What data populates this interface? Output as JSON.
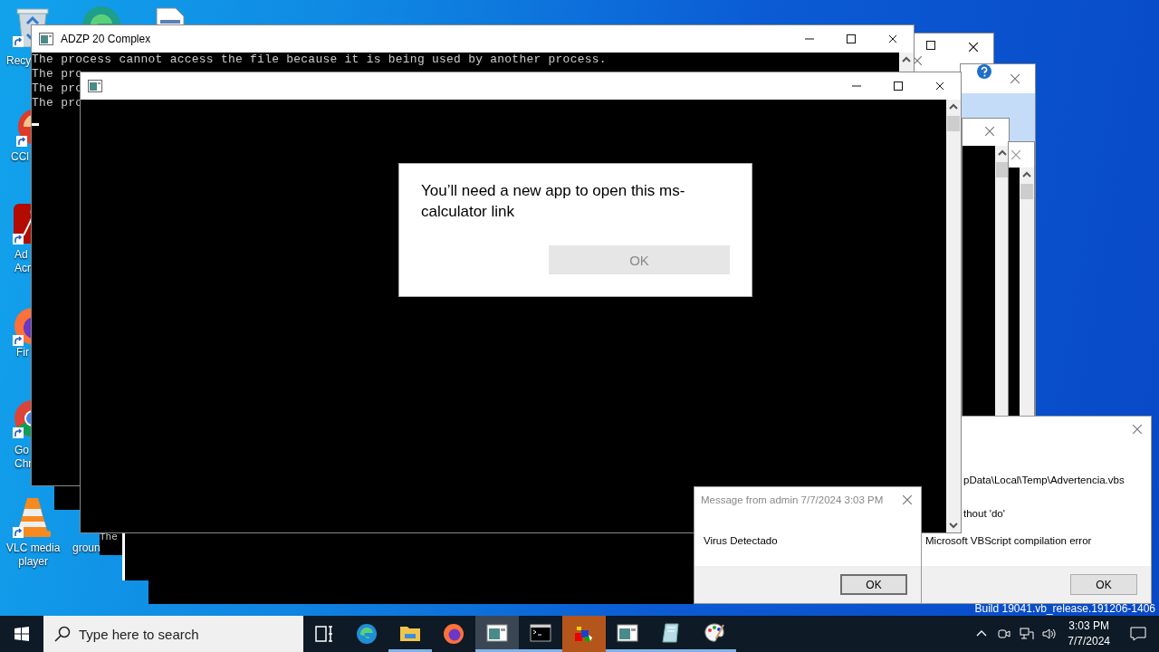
{
  "desktop_icons": [
    {
      "kind": "bin",
      "lines": [
        "Recy"
      ]
    },
    {
      "kind": "edge"
    },
    {
      "kind": "file"
    },
    {
      "kind": "cleaner",
      "lines": [
        "CCl"
      ]
    },
    {
      "kind": "acrobat",
      "lines": [
        "Ad",
        "Acr"
      ]
    },
    {
      "kind": "firefox",
      "lines": [
        "Fir"
      ]
    },
    {
      "kind": "chrome",
      "lines": [
        "Go",
        "Chr"
      ]
    },
    {
      "kind": "vlc",
      "lines": [
        "VLC media",
        "player"
      ]
    },
    {
      "kind": "hidden",
      "lines": [
        "groun"
      ]
    }
  ],
  "back_console": {
    "lines": [
      "The"
    ]
  },
  "main_console": {
    "title": "ADZP 20 Complex",
    "lines": [
      "The process cannot access the file because it is being used by another process.",
      "The pro",
      "The pro",
      "The pro"
    ]
  },
  "calc_dialog": {
    "message": "You’ll need a new app to open this ms-calculator link",
    "button": {
      "label": "OK",
      "disabled": true
    }
  },
  "script_error": {
    "lines": [
      "pData\\Local\\Temp\\Advertencia.vbs",
      "thout 'do'"
    ],
    "title": "Microsoft VBScript compilation error",
    "button": "OK"
  },
  "message_box": {
    "title": "Message from admin 7/7/2024 3:03 PM",
    "message": "Virus Detectado",
    "button": "OK"
  },
  "build_text": "Build 19041.vb_release.191206-1406",
  "taskbar": {
    "search": {
      "placeholder": "Type here to search"
    },
    "apps": [
      {
        "kind": "taskview",
        "selected": false,
        "flashing": false,
        "running": false
      },
      {
        "kind": "edge",
        "selected": false,
        "flashing": false,
        "running": false
      },
      {
        "kind": "folder",
        "selected": false,
        "flashing": false,
        "running": true
      },
      {
        "kind": "firefox",
        "selected": false,
        "flashing": false,
        "running": false
      },
      {
        "kind": "console",
        "selected": true,
        "flashing": false,
        "running": true
      },
      {
        "kind": "cmd",
        "selected": false,
        "flashing": false,
        "running": true
      },
      {
        "kind": "blocks",
        "selected": false,
        "flashing": true,
        "running": false
      },
      {
        "kind": "console",
        "selected": false,
        "flashing": false,
        "running": true
      },
      {
        "kind": "notepad",
        "selected": false,
        "flashing": false,
        "running": true
      },
      {
        "kind": "paint",
        "selected": false,
        "flashing": false,
        "running": true
      }
    ],
    "time": "3:03 PM",
    "date": "7/7/2024"
  }
}
